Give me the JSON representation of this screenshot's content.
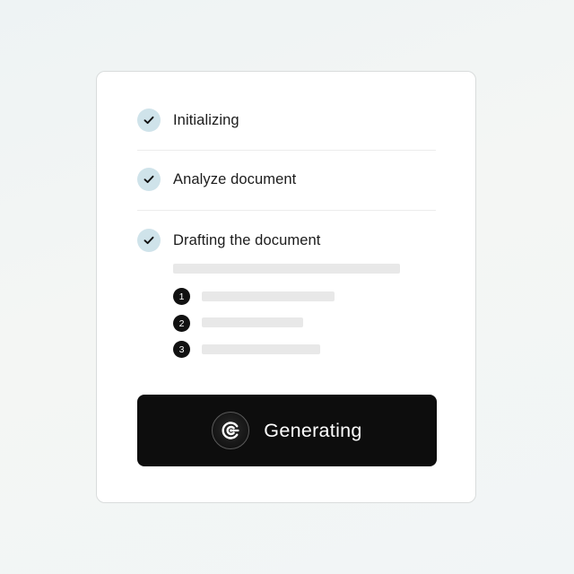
{
  "steps": [
    {
      "label": "Initializing",
      "status": "done"
    },
    {
      "label": "Analyze document",
      "status": "done"
    },
    {
      "label": "Drafting the document",
      "status": "done"
    }
  ],
  "outline": {
    "numbers": [
      "1",
      "2",
      "3"
    ]
  },
  "button": {
    "label": "Generating",
    "icon": "logo-spinner-icon"
  },
  "colors": {
    "check_bg": "#cfe3ea",
    "button_bg": "#0d0d0d",
    "skeleton": "#e8e8e8"
  }
}
